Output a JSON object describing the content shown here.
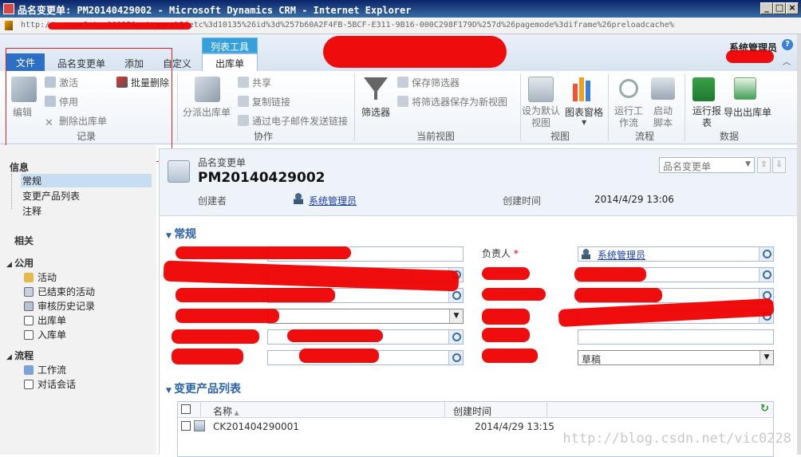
{
  "window": {
    "title": "品名变更单: PM20140429002 - Microsoft Dynamics CRM - Internet Explorer",
    "url": "http://                                     .aspx?etc=10135&extraqs=%3fetc%3d10135%26id%3d%257b60A2F4FB-5BCF-E311-9B16-000C298F179D%257d%26pagemode%3diframe%26preloadcache%"
  },
  "ribbon": {
    "tabs": {
      "file": "文件",
      "pmc": "品名变更单",
      "add": "添加",
      "custom": "自定义",
      "context_group": "列表工具",
      "outbound": "出库单"
    },
    "user": "系统管理员",
    "records": {
      "edit": "编辑",
      "activate": "激活",
      "deactivate": "停用",
      "bulk_delete": "批量删除",
      "delete": "删除出库单",
      "label": "记录"
    },
    "collab": {
      "assign": "分派出库单",
      "share": "共享",
      "copy_link": "复制链接",
      "email_link": "通过电子邮件发送链接",
      "label": "协作"
    },
    "view": {
      "filter": "筛选器",
      "save_filter": "保存筛选器",
      "save_as_new": "将筛选器保存为新视图",
      "label": "当前视图"
    },
    "view2": {
      "set_default": "设为默认视图",
      "chart_pane": "图表窗格",
      "label": "视图"
    },
    "process": {
      "run_workflow": "运行工作流",
      "start_dialog": "启动脚本",
      "label": "流程"
    },
    "data": {
      "run_report": "运行报表",
      "export": "导出出库单",
      "label": "数据"
    }
  },
  "nav": {
    "info": "信息",
    "general": "常规",
    "change_list": "变更产品列表",
    "notes": "注释",
    "related": "相关",
    "common": "公用",
    "activities": "活动",
    "closed_activities": "已结束的活动",
    "audit": "审核历史记录",
    "outbound": "出库单",
    "inbound": "入库单",
    "process": "流程",
    "workflows": "工作流",
    "dialogs": "对话会话"
  },
  "form": {
    "entity": "品名变更单",
    "record_id": "PM20140429002",
    "created_by_label": "创建者",
    "created_by": "系统管理员",
    "created_on_label": "创建时间",
    "created_on": "2014/4/29 13:06",
    "form_selector": "品名变更单",
    "section_general": "常规",
    "owner_label": "负责人",
    "owner": "系统管理员",
    "status_value": "草稿",
    "section_list": "变更产品列表"
  },
  "grid": {
    "col_name": "名称",
    "col_created": "创建时间",
    "rows": [
      {
        "name": "CK201404290001",
        "created": "2014/4/29 13:15"
      }
    ]
  },
  "watermark": "http://blog.csdn.net/vic0228"
}
